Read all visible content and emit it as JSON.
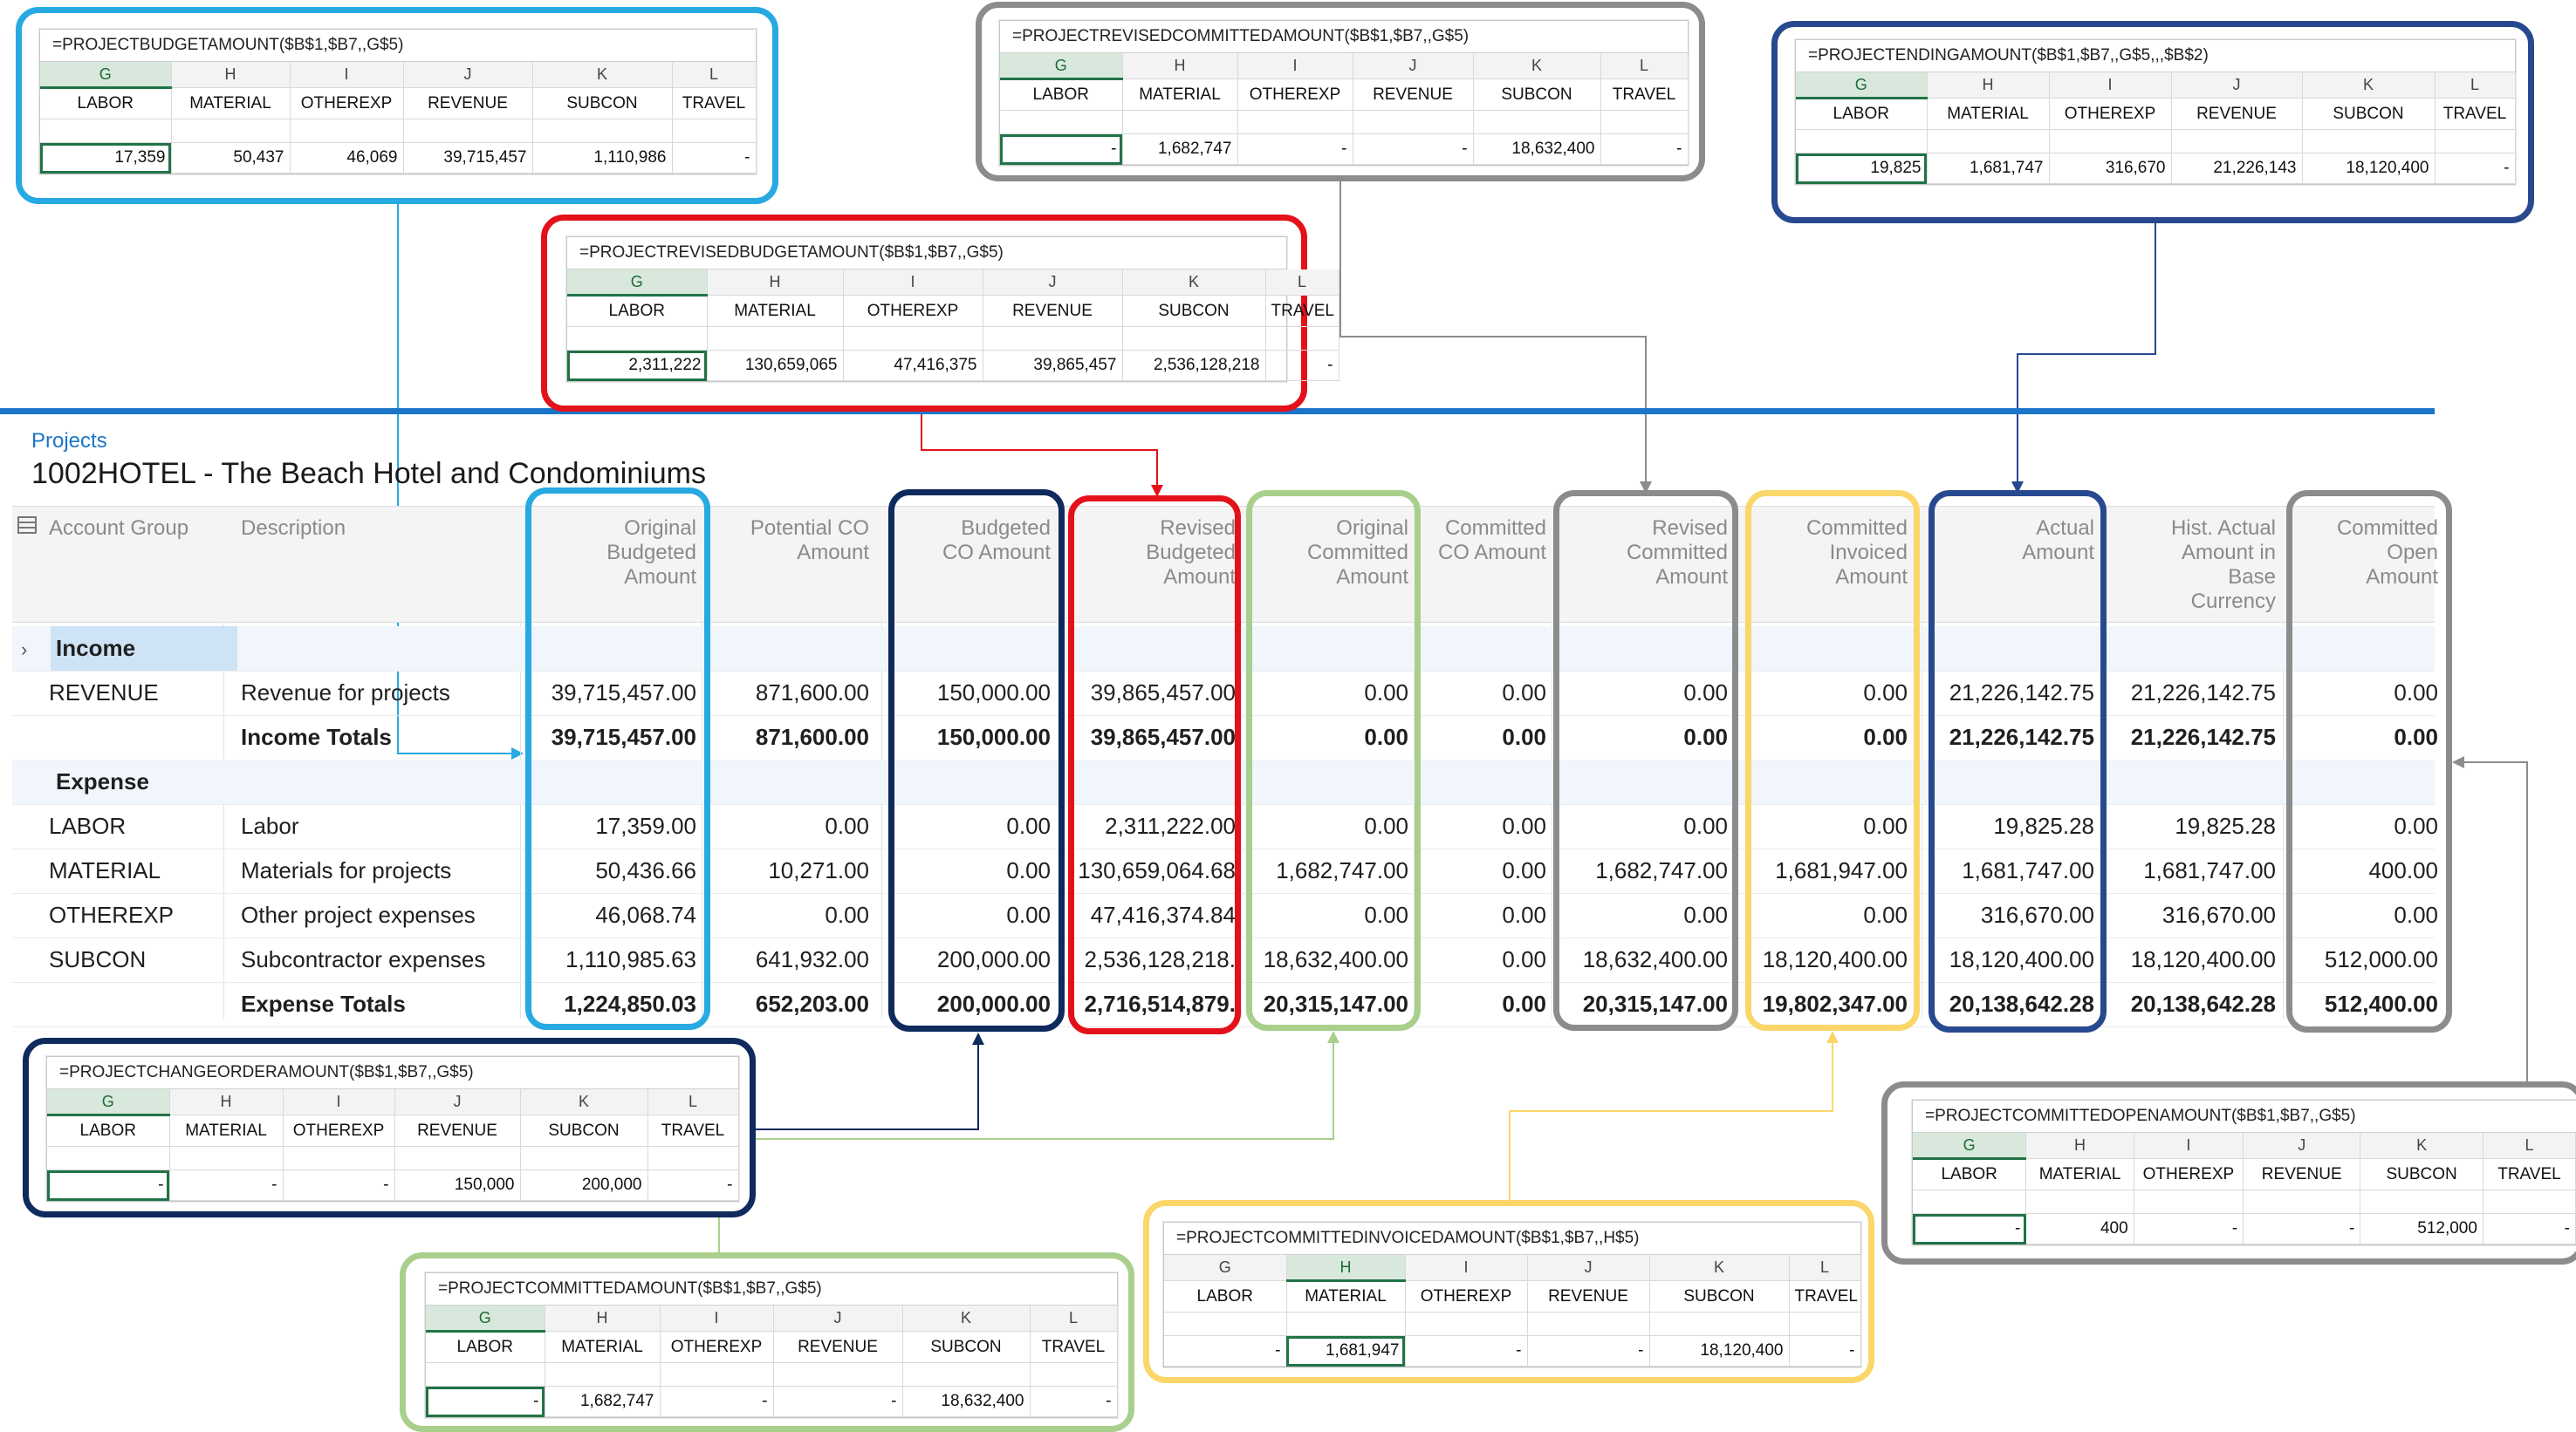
{
  "colors": {
    "cyan": "#27a9e1",
    "red": "#e3121a",
    "navy": "#0f2a5c",
    "green": "#a9cf8c",
    "gray": "#8c8c8c",
    "yellow": "#fbd769",
    "blue": "#27498f",
    "brand_blue": "#1b75c9",
    "excel_green": "#217346"
  },
  "breadcrumb": "Projects",
  "page_title": "1002HOTEL - The Beach Hotel and Condominiums",
  "grid": {
    "columns": [
      {
        "key": "account_group",
        "label": [
          "Account Group"
        ]
      },
      {
        "key": "description",
        "label": [
          "Description"
        ]
      },
      {
        "key": "original_budgeted",
        "label": [
          "Original",
          "Budgeted",
          "Amount"
        ]
      },
      {
        "key": "potential_co",
        "label": [
          "Potential CO",
          "Amount"
        ]
      },
      {
        "key": "budgeted_co",
        "label": [
          "Budgeted",
          "CO Amount"
        ]
      },
      {
        "key": "revised_budgeted",
        "label": [
          "Revised",
          "Budgeted",
          "Amount"
        ]
      },
      {
        "key": "original_committed",
        "label": [
          "Original",
          "Committed",
          "Amount"
        ]
      },
      {
        "key": "committed_co",
        "label": [
          "Committed",
          "CO Amount"
        ]
      },
      {
        "key": "revised_committed",
        "label": [
          "Revised",
          "Committed",
          "Amount"
        ]
      },
      {
        "key": "committed_invoiced",
        "label": [
          "Committed",
          "Invoiced",
          "Amount"
        ]
      },
      {
        "key": "actual",
        "label": [
          "Actual",
          "Amount"
        ]
      },
      {
        "key": "hist_actual",
        "label": [
          "Hist. Actual",
          "Amount in",
          "Base",
          "Currency"
        ]
      },
      {
        "key": "committed_open",
        "label": [
          "Committed",
          "Open",
          "Amount"
        ]
      }
    ],
    "groups": [
      {
        "name": "Income",
        "rows": [
          {
            "account": "REVENUE",
            "description": "Revenue for projects",
            "values": [
              "39,715,457.00",
              "871,600.00",
              "150,000.00",
              "39,865,457.00",
              "0.00",
              "0.00",
              "0.00",
              "0.00",
              "21,226,142.75",
              "21,226,142.75",
              "0.00"
            ]
          }
        ],
        "total": {
          "description": "Income Totals",
          "values": [
            "39,715,457.00",
            "871,600.00",
            "150,000.00",
            "39,865,457.00",
            "0.00",
            "0.00",
            "0.00",
            "0.00",
            "21,226,142.75",
            "21,226,142.75",
            "0.00"
          ]
        }
      },
      {
        "name": "Expense",
        "rows": [
          {
            "account": "LABOR",
            "description": "Labor",
            "values": [
              "17,359.00",
              "0.00",
              "0.00",
              "2,311,222.00",
              "0.00",
              "0.00",
              "0.00",
              "0.00",
              "19,825.28",
              "19,825.28",
              "0.00"
            ]
          },
          {
            "account": "MATERIAL",
            "description": "Materials for projects",
            "values": [
              "50,436.66",
              "10,271.00",
              "0.00",
              "130,659,064.68",
              "1,682,747.00",
              "0.00",
              "1,682,747.00",
              "1,681,947.00",
              "1,681,747.00",
              "1,681,747.00",
              "400.00"
            ]
          },
          {
            "account": "OTHEREXP",
            "description": "Other project expenses",
            "values": [
              "46,068.74",
              "0.00",
              "0.00",
              "47,416,374.84",
              "0.00",
              "0.00",
              "0.00",
              "0.00",
              "316,670.00",
              "316,670.00",
              "0.00"
            ]
          },
          {
            "account": "SUBCON",
            "description": "Subcontractor expenses",
            "values": [
              "1,110,985.63",
              "641,932.00",
              "200,000.00",
              "2,536,128,218.",
              "18,632,400.00",
              "0.00",
              "18,632,400.00",
              "18,120,400.00",
              "18,120,400.00",
              "18,120,400.00",
              "512,000.00"
            ]
          }
        ],
        "total": {
          "description": "Expense Totals",
          "values": [
            "1,224,850.03",
            "652,203.00",
            "200,000.00",
            "2,716,514,879.",
            "20,315,147.00",
            "0.00",
            "20,315,147.00",
            "19,802,347.00",
            "20,138,642.28",
            "20,138,642.28",
            "512,400.00"
          ]
        }
      }
    ]
  },
  "excel_callouts": [
    {
      "id": "budget",
      "formula": "=PROJECTBUDGETAMOUNT($B$1,$B7,,G$5)",
      "col_letters": [
        "G",
        "H",
        "I",
        "J",
        "K",
        "L"
      ],
      "labels": [
        "LABOR",
        "MATERIAL",
        "OTHEREXP",
        "REVENUE",
        "SUBCON",
        "TRAVEL"
      ],
      "values": [
        "17,359",
        "50,437",
        "46,069",
        "39,715,457",
        "1,110,986",
        "-"
      ],
      "active_col": 0
    },
    {
      "id": "revised_budget",
      "formula": "=PROJECTREVISEDBUDGETAMOUNT($B$1,$B7,,G$5)",
      "col_letters": [
        "G",
        "H",
        "I",
        "J",
        "K",
        "L"
      ],
      "labels": [
        "LABOR",
        "MATERIAL",
        "OTHEREXP",
        "REVENUE",
        "SUBCON",
        "TRAVEL"
      ],
      "values": [
        "2,311,222",
        "130,659,065",
        "47,416,375",
        "39,865,457",
        "2,536,128,218",
        "-"
      ],
      "active_col": 0
    },
    {
      "id": "revised_committed",
      "formula": "=PROJECTREVISEDCOMMITTEDAMOUNT($B$1,$B7,,G$5)",
      "col_letters": [
        "G",
        "H",
        "I",
        "J",
        "K",
        "L"
      ],
      "labels": [
        "LABOR",
        "MATERIAL",
        "OTHEREXP",
        "REVENUE",
        "SUBCON",
        "TRAVEL"
      ],
      "values": [
        "-",
        "1,682,747",
        "-",
        "-",
        "18,632,400",
        "-"
      ],
      "active_col": 0
    },
    {
      "id": "ending",
      "formula": "=PROJECTENDINGAMOUNT($B$1,$B7,,G$5,,,$B$2)",
      "col_letters": [
        "G",
        "H",
        "I",
        "J",
        "K",
        "L"
      ],
      "labels": [
        "LABOR",
        "MATERIAL",
        "OTHEREXP",
        "REVENUE",
        "SUBCON",
        "TRAVEL"
      ],
      "values": [
        "19,825",
        "1,681,747",
        "316,670",
        "21,226,143",
        "18,120,400",
        "-"
      ],
      "active_col": 0
    },
    {
      "id": "change_order",
      "formula": "=PROJECTCHANGEORDERAMOUNT($B$1,$B7,,G$5)",
      "col_letters": [
        "G",
        "H",
        "I",
        "J",
        "K",
        "L"
      ],
      "labels": [
        "LABOR",
        "MATERIAL",
        "OTHEREXP",
        "REVENUE",
        "SUBCON",
        "TRAVEL"
      ],
      "values": [
        "-",
        "-",
        "-",
        "150,000",
        "200,000",
        "-"
      ],
      "active_col": 0
    },
    {
      "id": "committed",
      "formula": "=PROJECTCOMMITTEDAMOUNT($B$1,$B7,,G$5)",
      "col_letters": [
        "G",
        "H",
        "I",
        "J",
        "K",
        "L"
      ],
      "labels": [
        "LABOR",
        "MATERIAL",
        "OTHEREXP",
        "REVENUE",
        "SUBCON",
        "TRAVEL"
      ],
      "values": [
        "-",
        "1,682,747",
        "-",
        "-",
        "18,632,400",
        "-"
      ],
      "active_col": 0
    },
    {
      "id": "committed_invoiced",
      "formula": "=PROJECTCOMMITTEDINVOICEDAMOUNT($B$1,$B7,,H$5)",
      "col_letters": [
        "G",
        "H",
        "I",
        "J",
        "K",
        "L"
      ],
      "labels": [
        "LABOR",
        "MATERIAL",
        "OTHEREXP",
        "REVENUE",
        "SUBCON",
        "TRAVEL"
      ],
      "values": [
        "-",
        "1,681,947",
        "-",
        "-",
        "18,120,400",
        "-"
      ],
      "active_col": 1
    },
    {
      "id": "committed_open",
      "formula": "=PROJECTCOMMITTEDOPENAMOUNT($B$1,$B7,,G$5)",
      "col_letters": [
        "G",
        "H",
        "I",
        "J",
        "K",
        "L"
      ],
      "labels": [
        "LABOR",
        "MATERIAL",
        "OTHEREXP",
        "REVENUE",
        "SUBCON",
        "TRAVEL"
      ],
      "values": [
        "-",
        "400",
        "-",
        "-",
        "512,000",
        "-"
      ],
      "active_col": 0
    }
  ]
}
